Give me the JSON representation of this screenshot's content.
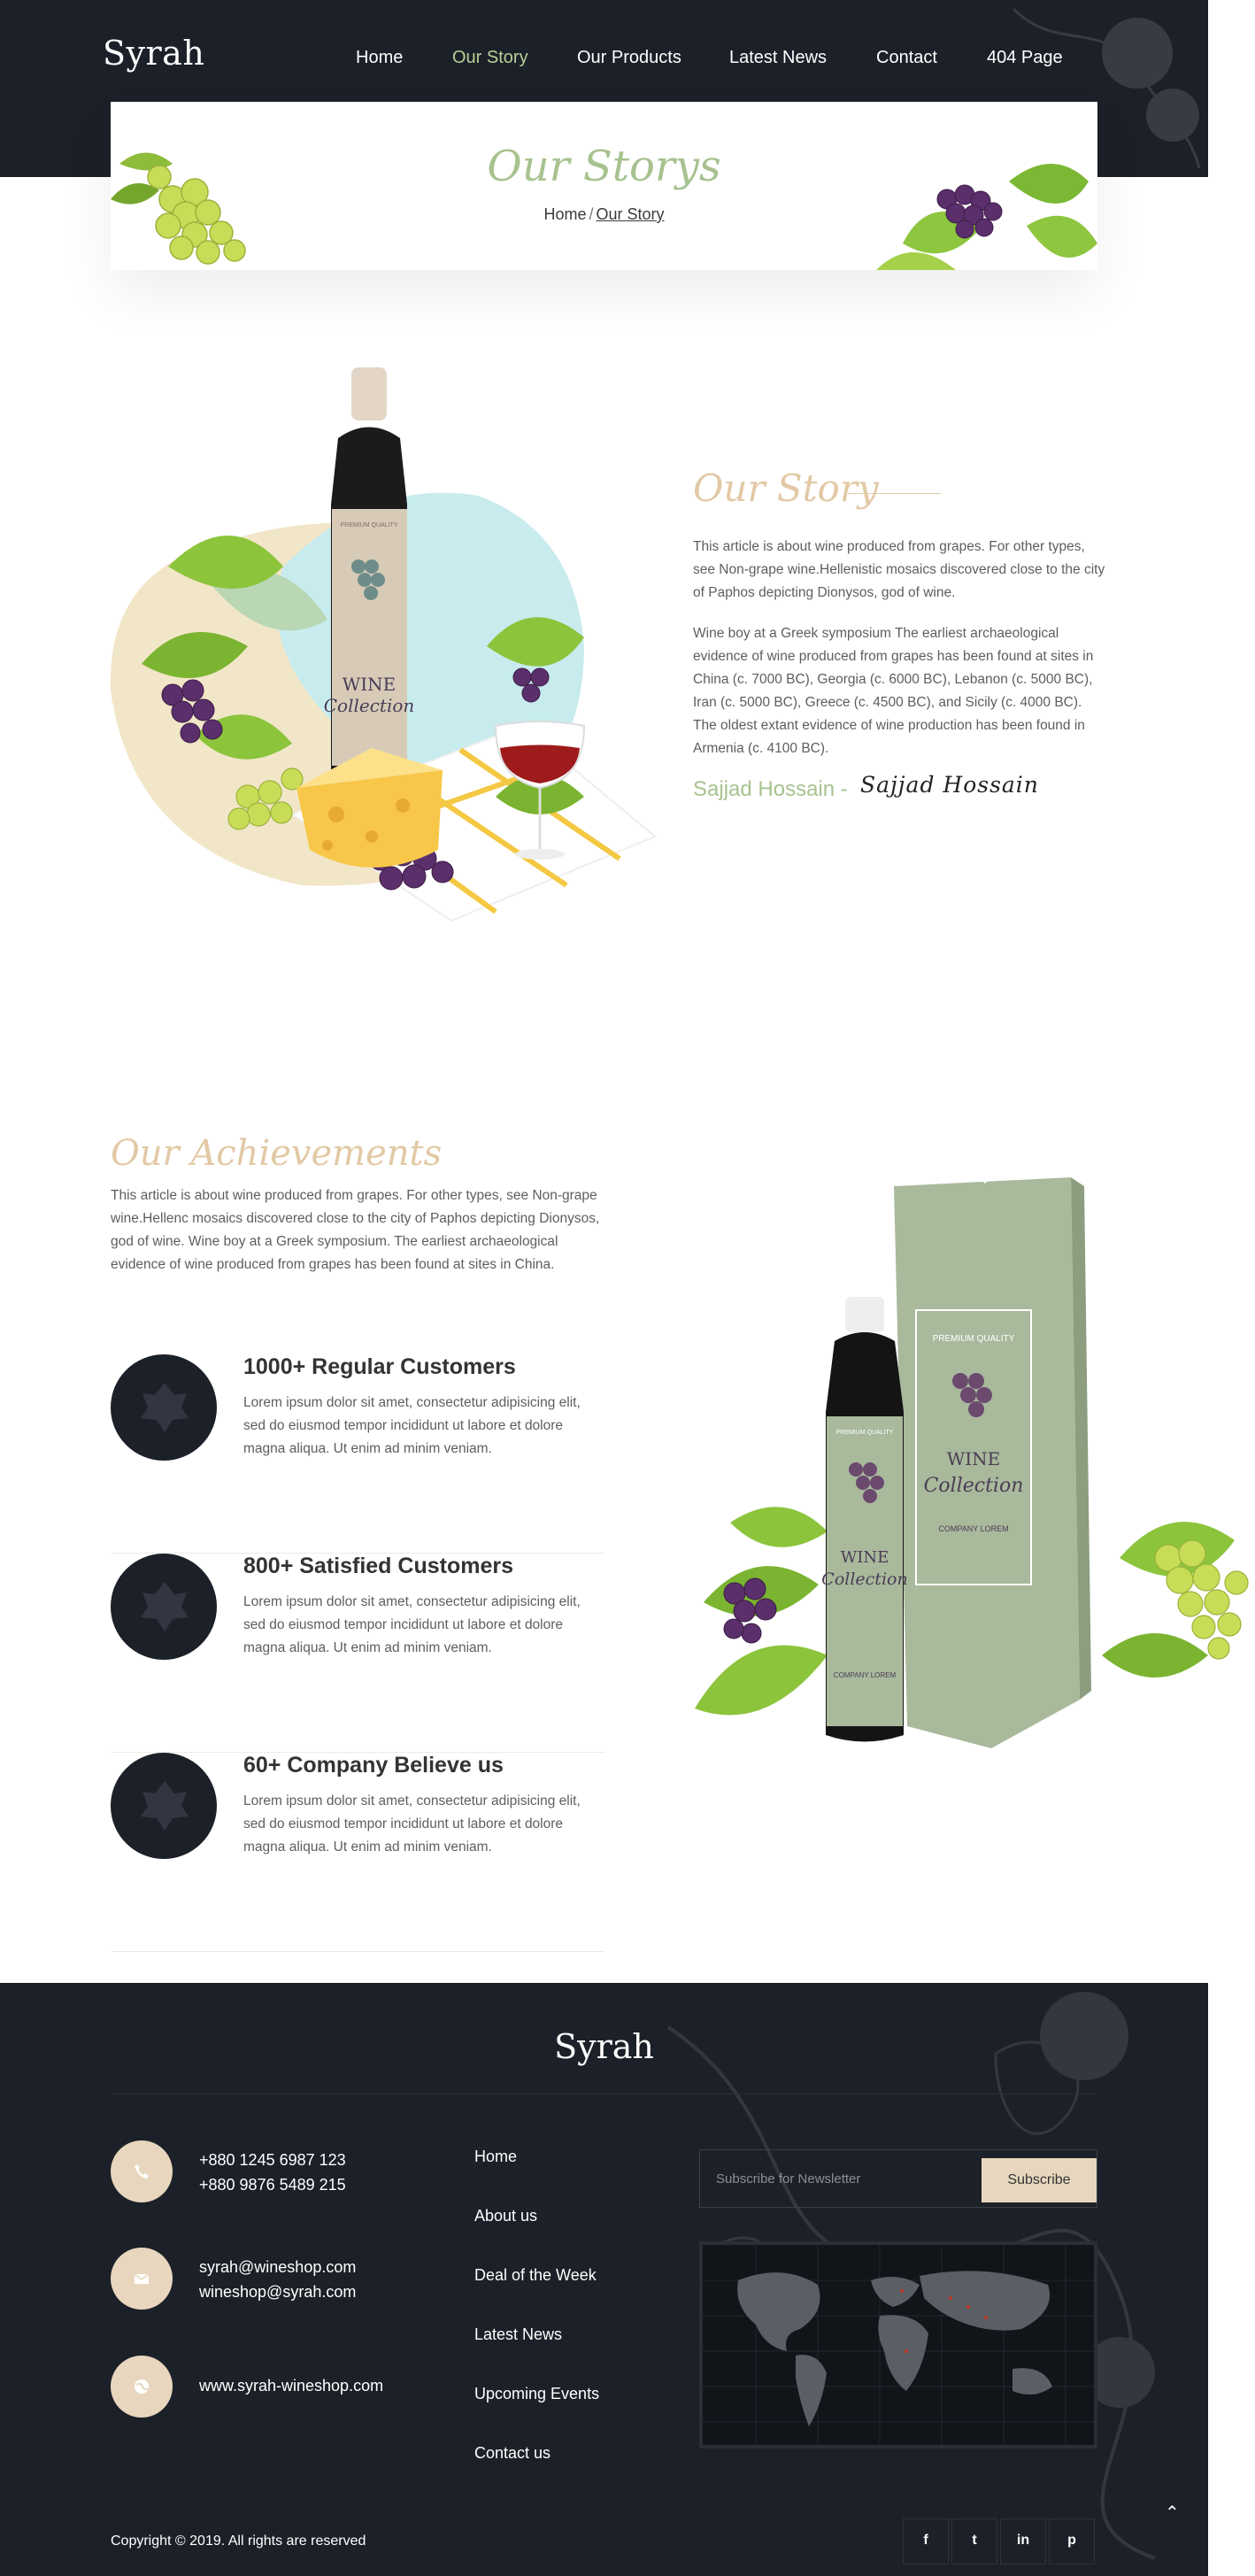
{
  "header": {
    "logo": "Syrah",
    "nav": [
      "Home",
      "Our Story",
      "Our Products",
      "Latest News",
      "Contact",
      "404 Page"
    ],
    "active_nav": "Our Story"
  },
  "banner": {
    "title": "Our Storys",
    "breadcrumb": {
      "home": "Home",
      "separator": "/",
      "current": "Our Story"
    }
  },
  "story": {
    "art_label": "WINE Collection",
    "title": "Our Story",
    "paragraphs": [
      "This article is about wine produced from grapes. For other types, see Non-grape wine.Hellenistic mosaics discovered close to the city of Paphos depicting Dionysos, god of wine.",
      "Wine boy at a Greek symposium The earliest archaeological evidence of wine produced from grapes has been found at sites in China (c. 7000 BC), Georgia (c. 6000 BC), Lebanon (c. 5000 BC), Iran (c. 5000 BC), Greece (c. 4500 BC), and Sicily (c. 4000 BC). The oldest extant evidence of wine production has been found in Armenia (c. 4100 BC)."
    ],
    "author": "Sajjad Hossain -",
    "signature": "Sajjad Hossain"
  },
  "achievements": {
    "title": "Our Achievements",
    "intro": "This article is about wine produced from grapes. For other types, see Non-grape wine.Hellenc mosaics discovered close to the city of Paphos depicting Dionysos, god of wine. Wine boy at a Greek symposium. The earliest archaeological evidence of wine produced from grapes has been found at sites in China.",
    "items": [
      {
        "title": "1000+ Regular Customers",
        "text": "Lorem ipsum dolor sit amet, consectetur adipisicing elit, sed do eiusmod tempor incididunt ut labore et dolore magna aliqua. Ut enim ad minim veniam."
      },
      {
        "title": "800+ Satisfied Customers",
        "text": "Lorem ipsum dolor sit amet, consectetur adipisicing elit, sed do eiusmod tempor incididunt ut labore et dolore magna aliqua. Ut enim ad minim veniam."
      },
      {
        "title": "60+ Company Believe us",
        "text": "Lorem ipsum dolor sit amet, consectetur adipisicing elit, sed do eiusmod tempor incididunt ut labore et dolore magna aliqua. Ut enim ad minim veniam."
      }
    ],
    "product_art": {
      "premium": "PREMIUM QUALITY",
      "wine": "WINE",
      "collection": "Collection",
      "company": "COMPANY LOREM"
    }
  },
  "footer": {
    "logo": "Syrah",
    "contacts": [
      {
        "icon": "phone-icon",
        "lines": [
          "+880 1245 6987 123",
          "+880 9876 5489 215"
        ]
      },
      {
        "icon": "envelope-icon",
        "lines": [
          "syrah@wineshop.com",
          "wineshop@syrah.com"
        ]
      },
      {
        "icon": "globe-icon",
        "lines": [
          "www.syrah-wineshop.com"
        ]
      }
    ],
    "links": [
      "Home",
      "About us",
      "Deal of the Week",
      "Latest News",
      "Upcoming Events",
      "Contact us"
    ],
    "newsletter": {
      "placeholder": "Subscribe for Newsletter",
      "button": "Subscribe"
    },
    "copyright": "Copyright © 2019. All rights are reserved",
    "social": [
      {
        "icon": "facebook-icon",
        "glyph": "f"
      },
      {
        "icon": "twitter-icon",
        "glyph": "t"
      },
      {
        "icon": "linkedin-icon",
        "glyph": "in"
      },
      {
        "icon": "pinterest-icon",
        "glyph": "p"
      }
    ],
    "scroll_top_glyph": "⌃"
  },
  "colors": {
    "dark": "#1c2028",
    "sage": "#a7c28f",
    "beige": "#e8d7be",
    "script": "#e2c9a5",
    "nav_active": "#b8cf98"
  }
}
